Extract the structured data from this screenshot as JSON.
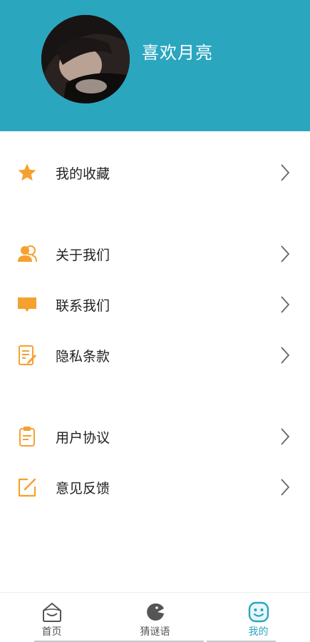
{
  "profile": {
    "username": "喜欢月亮"
  },
  "menu": {
    "groups": [
      {
        "items": [
          {
            "label": "我的收藏",
            "icon": "star-icon"
          }
        ]
      },
      {
        "items": [
          {
            "label": "关于我们",
            "icon": "users-icon"
          },
          {
            "label": "联系我们",
            "icon": "chat-bubble-icon"
          },
          {
            "label": "隐私条款",
            "icon": "document-edit-icon"
          }
        ]
      },
      {
        "items": [
          {
            "label": "用户协议",
            "icon": "clipboard-icon"
          },
          {
            "label": "意见反馈",
            "icon": "feedback-edit-icon"
          }
        ]
      }
    ]
  },
  "tabbar": {
    "tabs": [
      {
        "label": "首页",
        "icon": "home-face-icon"
      },
      {
        "label": "猜谜语",
        "icon": "pacman-icon"
      },
      {
        "label": "我的",
        "icon": "smile-face-icon",
        "active": true
      }
    ]
  },
  "colors": {
    "header": "#2ba6bf",
    "accent_icon": "#f5a12f",
    "active_tab": "#2ba6bf"
  }
}
